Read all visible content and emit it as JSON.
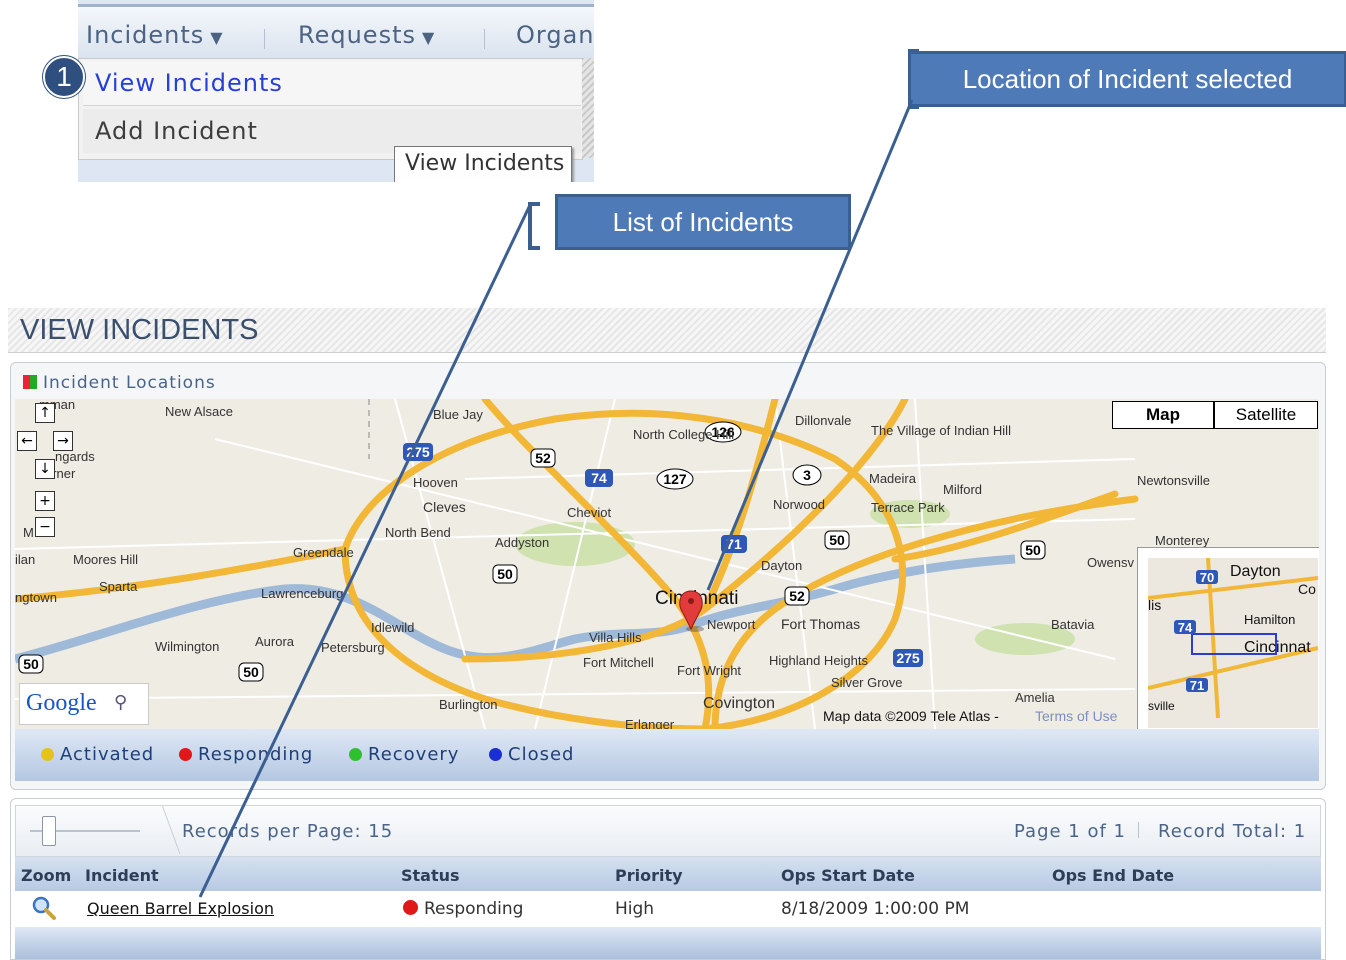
{
  "menu": {
    "items": [
      {
        "label": "Incidents"
      },
      {
        "label": "Requests"
      },
      {
        "label": "Organ"
      }
    ],
    "dropdown": [
      "View Incidents",
      "Add Incident"
    ],
    "tooltip": "View Incidents"
  },
  "step_badge": "1",
  "callouts": {
    "list": "List of Incidents",
    "location": "Location of Incident selected"
  },
  "page": {
    "title": "VIEW INCIDENTS",
    "panel_title": "Incident Locations"
  },
  "map": {
    "type_buttons": [
      "Map",
      "Satellite"
    ],
    "attribution": "Map data ©2009 Tele Atlas -",
    "terms": "Terms of Use",
    "logo": "Google",
    "places": [
      "mman",
      "New Alsace",
      "Blue Jay",
      "North College Hill",
      "Dillonvale",
      "The Village of Indian Hill",
      "ngards",
      "orner",
      "Hooven",
      "Cheviot",
      "Madeira",
      "Milford",
      "Newtonsville",
      "Cleves",
      "North Bend",
      "Norwood",
      "Terrace Park",
      "Addyston",
      "Greendale",
      "Moores Hill",
      "Sparta",
      "Lawrenceburg",
      "Dayton",
      "Monterey",
      "Owensv",
      "ngtown",
      "Cincinnati",
      "Newport",
      "Fort Thomas",
      "Idlewild",
      "Petersburg",
      "Villa Hills",
      "Fort Mitchell",
      "Fort Wright",
      "Highland Heights",
      "Silver Grove",
      "Batavia",
      "Wilmington",
      "Aurora",
      "Burlington",
      "Covington",
      "Amelia",
      "Erlanger",
      "ilan",
      "M"
    ],
    "shields": [
      "126",
      "275",
      "52",
      "74",
      "127",
      "3",
      "50",
      "71",
      "52",
      "50",
      "50",
      "50",
      "275",
      "50"
    ],
    "overview": {
      "places": [
        "Dayton",
        "Hamilton",
        "Cincinnat",
        "lis",
        "sville",
        "Co"
      ],
      "shields": [
        "70",
        "74",
        "71"
      ]
    }
  },
  "legend": [
    {
      "label": "Activated",
      "color": "#e5c21c"
    },
    {
      "label": "Responding",
      "color": "#e01818"
    },
    {
      "label": "Recovery",
      "color": "#2ec02e"
    },
    {
      "label": "Closed",
      "color": "#1a2fd1"
    }
  ],
  "pager": {
    "records_per_page": "Records per Page: 15",
    "page_info": "Page 1 of 1",
    "record_total": "Record Total: 1"
  },
  "grid": {
    "headers": [
      "Zoom",
      "Incident",
      "Status",
      "Priority",
      "Ops Start Date",
      "Ops End Date"
    ],
    "rows": [
      {
        "incident": "Queen Barrel Explosion",
        "status": "Responding",
        "status_color": "#e01818",
        "priority": "High",
        "ops_start": "8/18/2009 1:00:00 PM",
        "ops_end": ""
      }
    ]
  }
}
